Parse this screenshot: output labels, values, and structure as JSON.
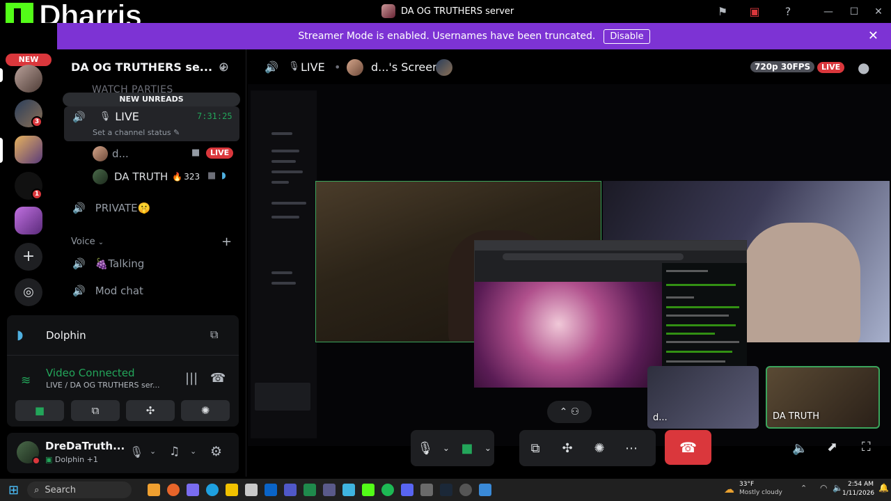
{
  "brand": {
    "name": "Dharris"
  },
  "titlebar": {
    "server_title": "DA OG TRUTHERS server"
  },
  "banner": {
    "text": "Streamer Mode is enabled. Usernames have been truncated.",
    "button": "Disable"
  },
  "rail": {
    "new_label": "NEW",
    "badges": [
      "3",
      "1"
    ]
  },
  "sidebar": {
    "server_name": "DA OG TRUTHERS se...",
    "faded_category": "WATCH PARTIES",
    "new_unreads": "NEW UNREADS",
    "live_channel": {
      "name": "LIVE",
      "timer": "7:31:25",
      "status": "Set a channel status"
    },
    "members": [
      {
        "name": "d...",
        "badge": "LIVE"
      },
      {
        "name": "DA TRUTH",
        "count": "323"
      }
    ],
    "private_channel": "PRIVATE🤫",
    "voice_header": "Voice",
    "voice_channels": [
      "🍇Talking",
      "Mod chat"
    ]
  },
  "voice_panel": {
    "activity": "Dolphin",
    "connection_status": "Video Connected",
    "connection_detail": "LIVE / DA OG TRUTHERS ser..."
  },
  "user": {
    "name": "DreDaTruth...",
    "activity": "Dolphin +1"
  },
  "stage": {
    "channel_label": "LIVE",
    "screen_label": "d...'s Screen",
    "quality": "720p 30FPS",
    "live_badge": "LIVE",
    "thumbnails": [
      "d...",
      "DA TRUTH"
    ]
  },
  "taskbar": {
    "search_placeholder": "Search",
    "weather_temp": "33°F",
    "weather_desc": "Mostly cloudy",
    "time": "2:54 AM",
    "date": "1/11/2026"
  },
  "colors": {
    "accent": "#7d33d4",
    "live": "#da373c",
    "connected": "#23a55a",
    "kick_green": "#53fc18"
  }
}
